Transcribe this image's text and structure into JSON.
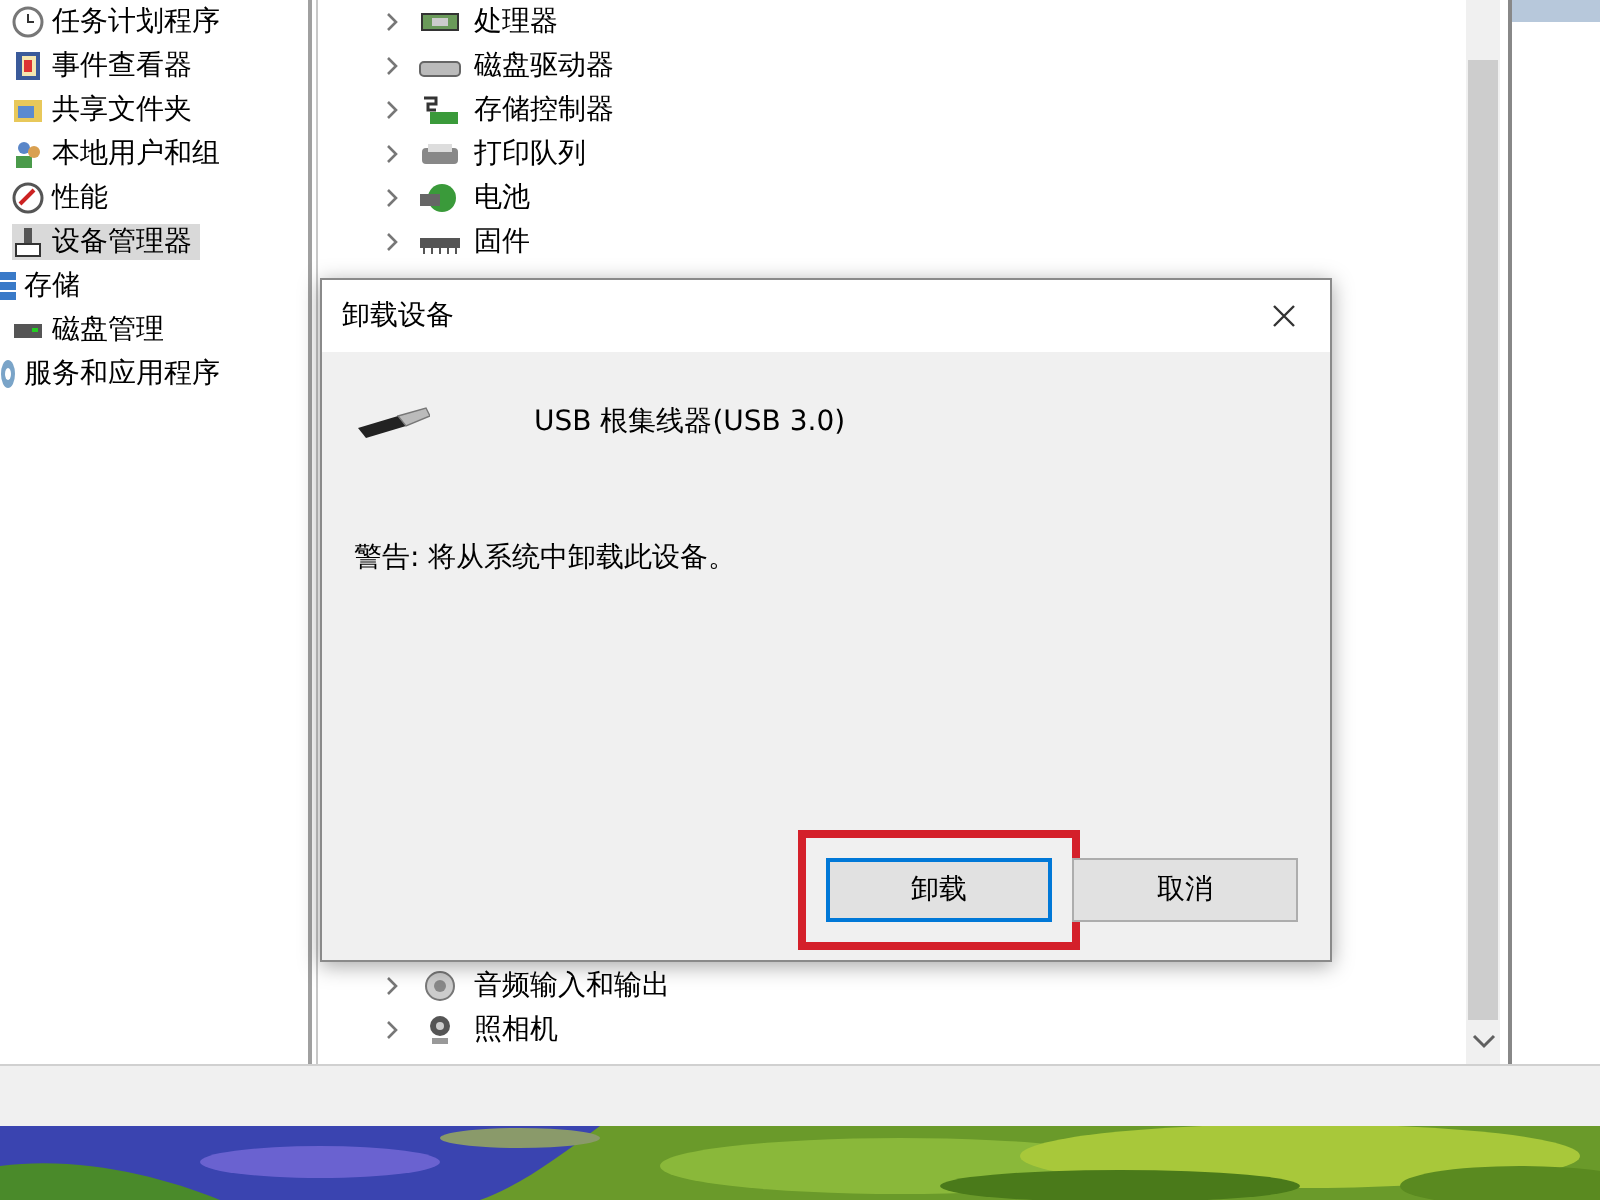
{
  "left_tree": [
    {
      "children": [
        {
          "label": "任务计划程序",
          "selected": false
        },
        {
          "label": "事件查看器",
          "selected": false
        },
        {
          "label": "共享文件夹",
          "selected": false
        },
        {
          "label": "本地用户和组",
          "selected": false
        },
        {
          "label": "性能",
          "selected": false
        },
        {
          "label": "设备管理器",
          "selected": true
        }
      ]
    },
    {
      "label": "存储",
      "selected": false,
      "children": [
        {
          "label": "磁盘管理",
          "selected": false
        }
      ]
    },
    {
      "label": "服务和应用程序",
      "selected": false
    }
  ],
  "device_tree": {
    "top": [
      {
        "label": "处理器"
      },
      {
        "label": "磁盘驱动器"
      },
      {
        "label": "存储控制器"
      },
      {
        "label": "打印队列"
      },
      {
        "label": "电池"
      },
      {
        "label": "固件"
      }
    ],
    "bottom": [
      {
        "label": "音频输入和输出"
      },
      {
        "label": "照相机"
      }
    ]
  },
  "dialog": {
    "title": "卸载设备",
    "device": "USB 根集线器(USB 3.0)",
    "warning": "警告: 将从系统中卸载此设备。",
    "buttons": [
      {
        "label": "卸载",
        "focused": true,
        "highlighted": true
      },
      {
        "label": "取消",
        "focused": false,
        "highlighted": false
      }
    ]
  }
}
